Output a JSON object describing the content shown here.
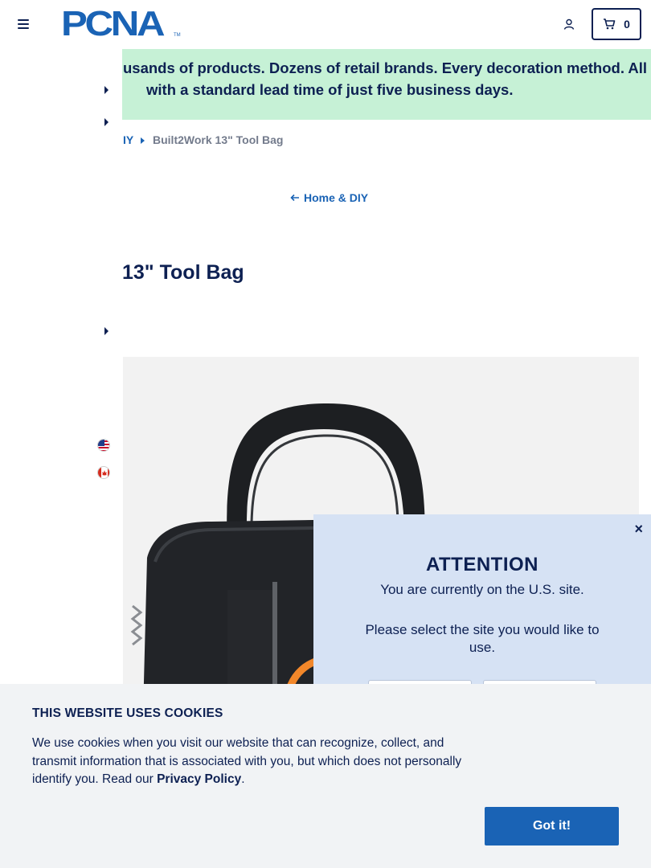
{
  "header": {
    "logo_text": "PCNA",
    "logo_tm": "TM",
    "cart_count": "0",
    "icons": {
      "menu": "hamburger-icon",
      "account": "user-icon",
      "cart": "cart-icon"
    }
  },
  "banner": {
    "line1": "usands of products. Dozens of retail brands. Every decoration method. All",
    "line2": "with a standard lead time of just five business days."
  },
  "breadcrumb": {
    "partial_parent": "IY",
    "current": "Built2Work 13\" Tool Bag"
  },
  "back_link": {
    "label": "Home & DIY"
  },
  "product": {
    "title_partial": "13\" Tool Bag"
  },
  "sidebar": {
    "flags": [
      "us-flag-icon",
      "canada-flag-icon"
    ]
  },
  "attention": {
    "close_label": "×",
    "title": "ATTENTION",
    "line1": "You are currently on the U.S. site.",
    "line2": "Please select the site you would like to use."
  },
  "cookies": {
    "title": "THIS WEBSITE USES COOKIES",
    "text_before": "We use cookies when you visit our website that can recognize, collect, and transmit information that is associated with you, but which does not personally identify you. Read our ",
    "policy_link": "Privacy Policy",
    "text_after": ".",
    "accept_label": "Got it!"
  },
  "colors": {
    "navy": "#0d2052",
    "brand_blue": "#1a63b5",
    "banner_green": "#c6f1d6",
    "modal_blue": "#d6e2f4",
    "cookie_bg": "#f1f3f5"
  }
}
